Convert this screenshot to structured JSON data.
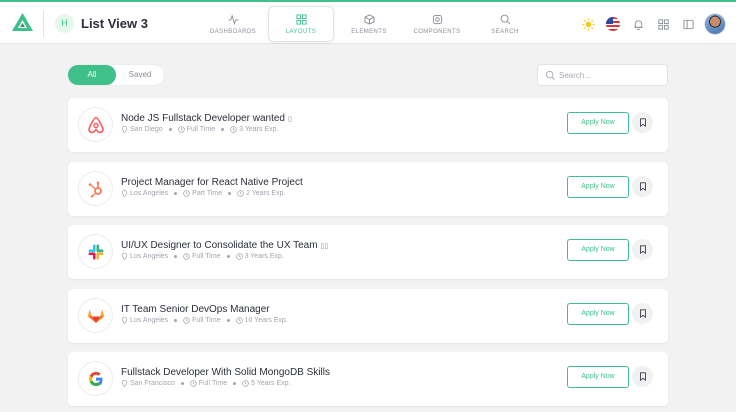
{
  "header": {
    "page_title": "List View 3",
    "page_avatar_letter": "H",
    "accent_color": "#3fbf8a",
    "nav": [
      {
        "label": "DASHBOARDS",
        "icon": "pulse-icon"
      },
      {
        "label": "LAYOUTS",
        "icon": "grid-icon",
        "active": true
      },
      {
        "label": "ELEMENTS",
        "icon": "cube-icon"
      },
      {
        "label": "COMPONENTS",
        "icon": "cog-icon"
      },
      {
        "label": "SEARCH",
        "icon": "search-icon"
      }
    ],
    "right_icons": [
      "sun-icon",
      "us-flag-icon",
      "bell-icon",
      "apps-grid-icon",
      "sidebar-toggle-icon",
      "user-avatar"
    ]
  },
  "filters": {
    "tabs": [
      {
        "label": "All",
        "active": true
      },
      {
        "label": "Saved",
        "active": false
      }
    ],
    "search_placeholder": "Search..."
  },
  "jobs": [
    {
      "title": "Node JS Fullstack Developer wanted",
      "emoji": "▯",
      "company_icon": "airbnb-icon",
      "brand_color": "#ff5a5f",
      "location": "San Diego",
      "type": "Full Time",
      "experience": "3 Years Exp.",
      "apply_label": "Apply Now"
    },
    {
      "title": "Project Manager for React Native Project",
      "emoji": "",
      "company_icon": "hubspot-icon",
      "brand_color": "#ff7a59",
      "location": "Los Angeles",
      "type": "Part Time",
      "experience": "2 Years Exp.",
      "apply_label": "Apply Now"
    },
    {
      "title": "UI/UX Designer to Consolidate the UX Team",
      "emoji": "▯▯",
      "company_icon": "slack-icon",
      "brand_color": "#4a154b",
      "location": "Los Angeles",
      "type": "Full Time",
      "experience": "3 Years Exp.",
      "apply_label": "Apply Now"
    },
    {
      "title": "IT Team Senior DevOps Manager",
      "emoji": "",
      "company_icon": "gitlab-icon",
      "brand_color": "#fc6d26",
      "location": "Los Angeles",
      "type": "Full Time",
      "experience": "10 Years Exp.",
      "apply_label": "Apply Now"
    },
    {
      "title": "Fullstack Developer With Solid MongoDB Skills",
      "emoji": "",
      "company_icon": "google-icon",
      "brand_color": "#4285f4",
      "location": "San Francisco",
      "type": "Full Time",
      "experience": "5 Years Exp.",
      "apply_label": "Apply Now"
    }
  ]
}
